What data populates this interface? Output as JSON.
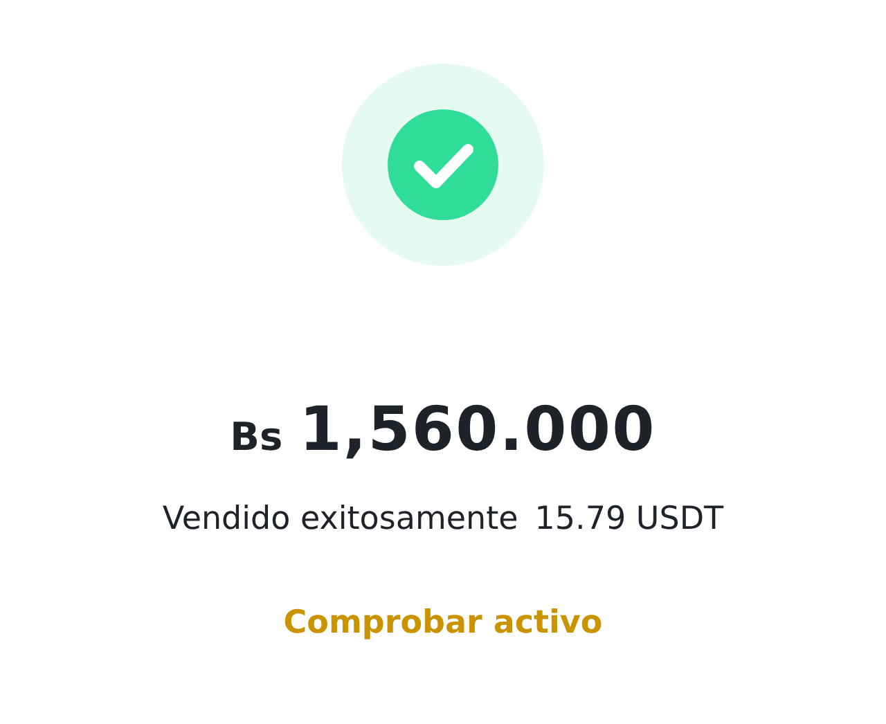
{
  "status": {
    "kind": "success"
  },
  "amount": {
    "currency": "Bs",
    "value": "1,560.000"
  },
  "message": {
    "text": "Vendido exitosamente",
    "crypto_amount": "15.79 USDT"
  },
  "link": {
    "label": "Comprobar activo"
  }
}
